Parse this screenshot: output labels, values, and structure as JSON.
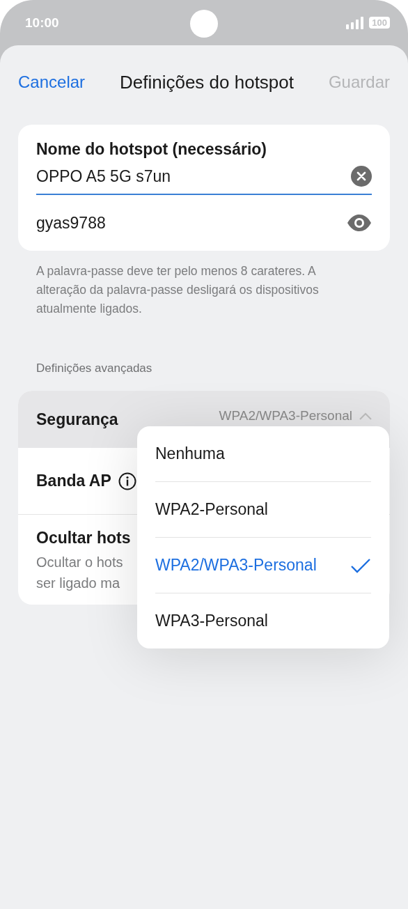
{
  "status_bar": {
    "time": "10:00",
    "battery": "100"
  },
  "header": {
    "cancel": "Cancelar",
    "title": "Definições do hotspot",
    "save": "Guardar",
    "save_disabled": true
  },
  "hotspot_card": {
    "name_label": "Nome do hotspot (necessário)",
    "name_value": "OPPO A5 5G s7un",
    "name_focused": true,
    "password_value": "gyas9788"
  },
  "hint": "A palavra-passe deve ter pelo menos 8 carateres. A alteração da palavra-passe desligará os dispositivos atualmente ligados.",
  "section_title": "Definições avançadas",
  "settings": [
    {
      "kind": "select",
      "label": "Segurança",
      "value": "WPA2/WPA3-Personal",
      "pressed": true
    },
    {
      "kind": "info",
      "label": "Banda AP",
      "pressed": false
    },
    {
      "kind": "text",
      "label": "Ocultar hots",
      "description": [
        "Ocultar o hots",
        "ser ligado ma"
      ],
      "pressed": false
    }
  ],
  "security_menu": [
    {
      "label": "Nenhuma",
      "selected": false
    },
    {
      "label": "WPA2-Personal",
      "selected": false
    },
    {
      "label": "WPA2/WPA3-Personal",
      "selected": true
    },
    {
      "label": "WPA3-Personal",
      "selected": false
    }
  ]
}
